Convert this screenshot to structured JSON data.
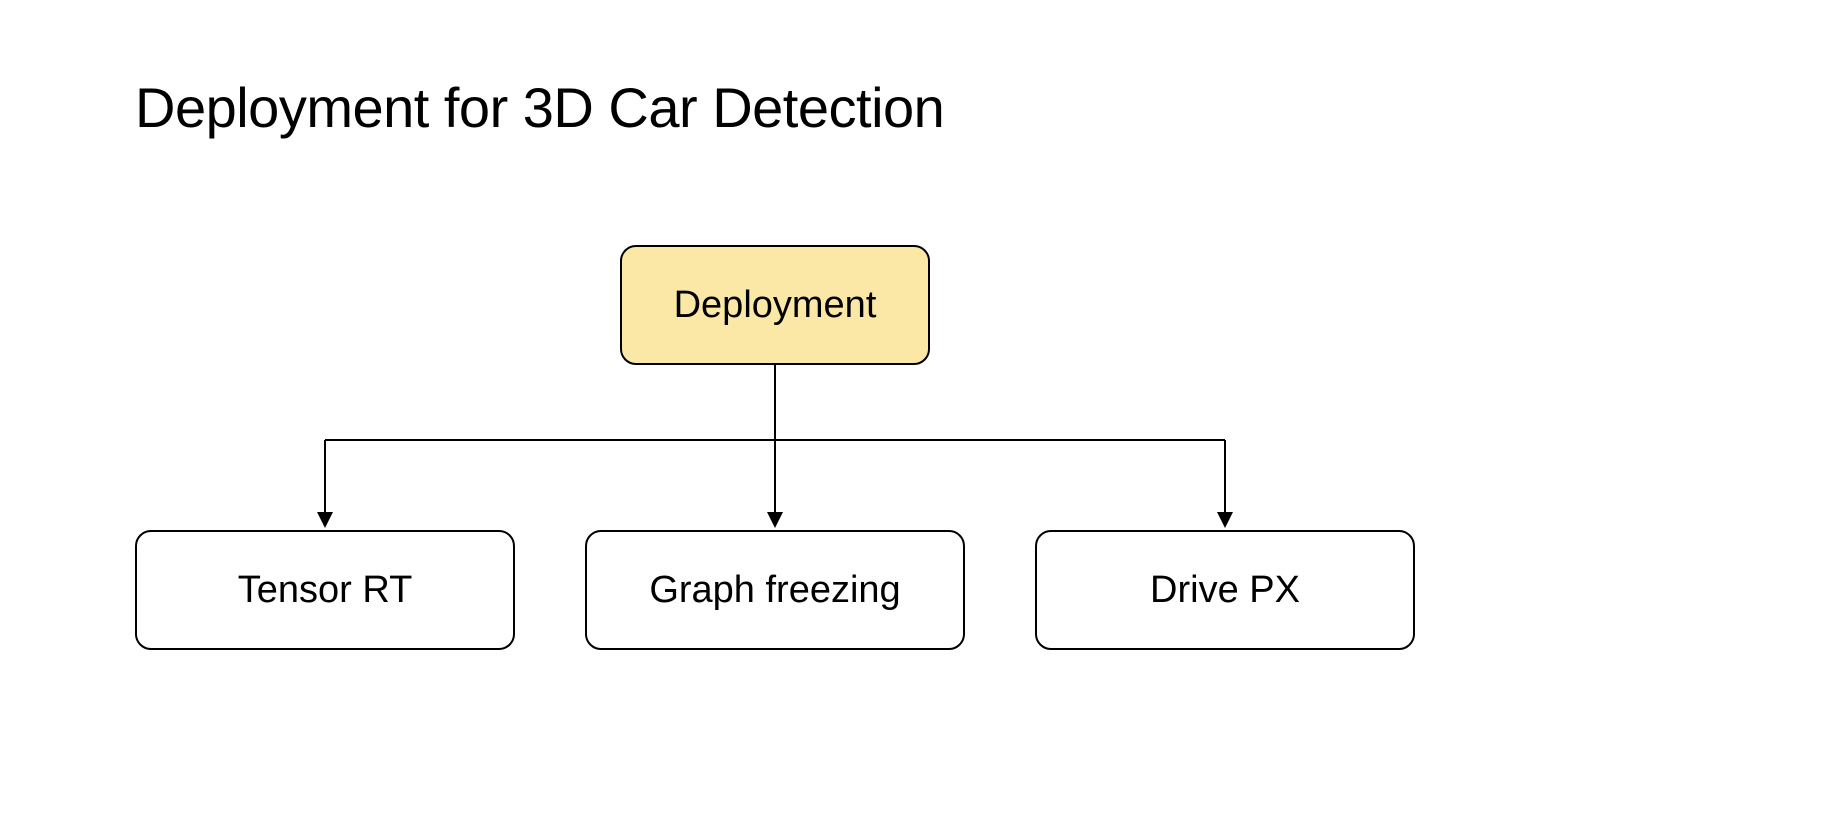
{
  "title": "Deployment for 3D Car Detection",
  "diagram": {
    "root": {
      "label": "Deployment"
    },
    "children": [
      {
        "label": "Tensor RT"
      },
      {
        "label": "Graph freezing"
      },
      {
        "label": "Drive PX"
      }
    ]
  },
  "colors": {
    "root_fill": "#fbe8a6",
    "child_fill": "#ffffff",
    "stroke": "#000000"
  }
}
